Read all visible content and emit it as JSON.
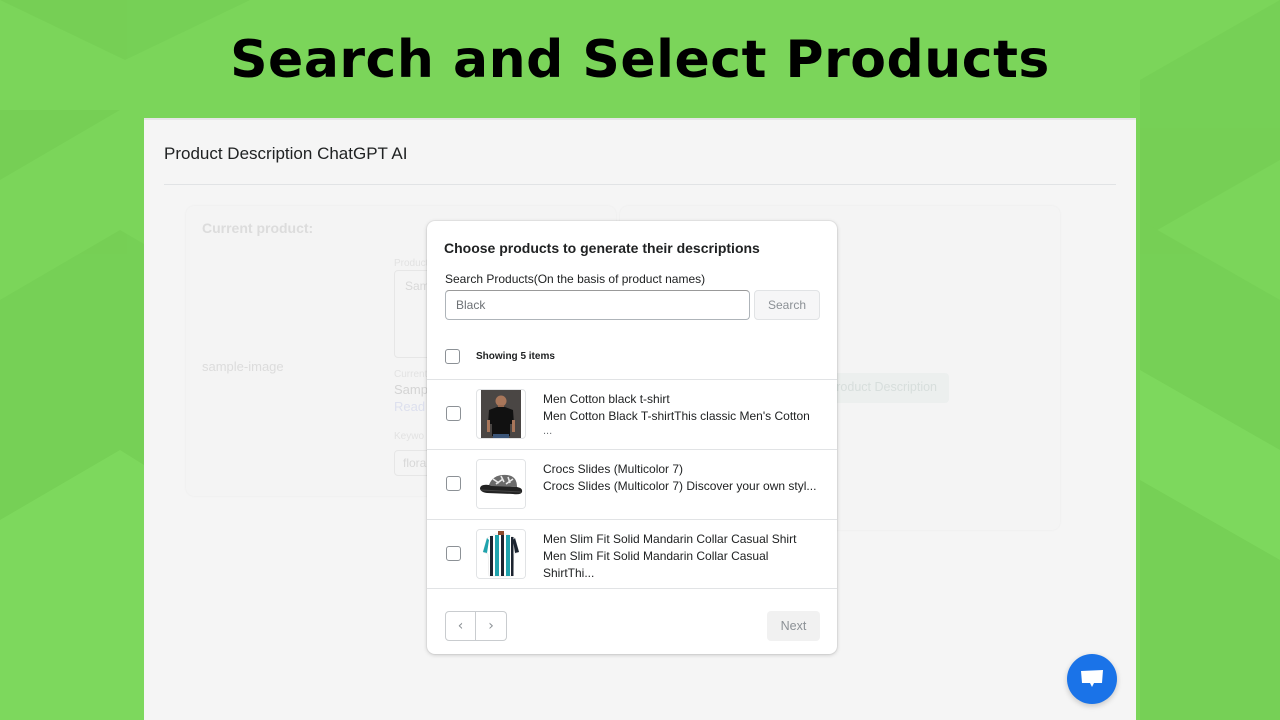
{
  "hero": {
    "title": "Search and Select Products"
  },
  "app": {
    "title": "Product Description ChatGPT AI",
    "background": {
      "current_product_label": "Current product:",
      "image_alt": "sample-image",
      "product_label": "Product",
      "textarea_value": "Sam",
      "current_label": "Current",
      "sample_text": "Sampl",
      "read_more": "Read m",
      "keywords_label": "Keywo",
      "keyword_value": "floral",
      "generate_button": "Generate Product Description"
    }
  },
  "modal": {
    "title": "Choose products to generate their descriptions",
    "search_label": "Search Products(On the basis of product names)",
    "search_value": "Black",
    "search_button": "Search",
    "showing_text": "Showing 5 items",
    "items": [
      {
        "title": "Men Cotton black t-shirt",
        "description": "Men Cotton Black T-shirtThis classic Men's Cotton",
        "ellipsis": "...",
        "image": "black-tshirt-model",
        "checked": false
      },
      {
        "title": "Crocs Slides (Multicolor 7)",
        "description": "Crocs Slides (Multicolor 7) Discover your own styl...",
        "ellipsis": "",
        "image": "multicolor-slide-sandal",
        "checked": false
      },
      {
        "title": "Men Slim Fit Solid Mandarin Collar Casual Shirt",
        "description": "Men Slim Fit Solid Mandarin Collar Casual ShirtThi...",
        "ellipsis": "",
        "image": "striped-casual-shirt",
        "checked": false
      }
    ],
    "pager": {
      "prev_icon": "‹",
      "next_icon": "›"
    },
    "next_button": "Next"
  },
  "chat": {
    "icon": "chat-bubble-icon"
  },
  "colors": {
    "background_green": "#7bd55a",
    "chat_blue": "#1a73e8",
    "app_surface": "#f5f5f5"
  }
}
